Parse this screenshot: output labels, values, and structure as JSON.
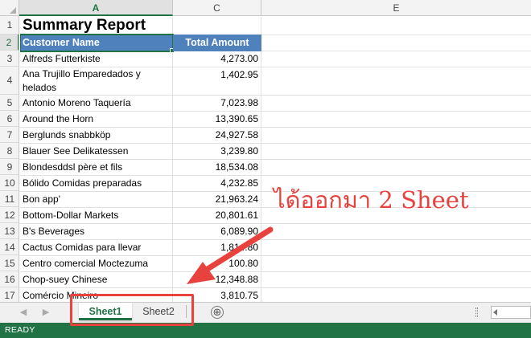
{
  "columns": [
    {
      "letter": "A",
      "selected": true
    },
    {
      "letter": "C",
      "selected": false
    },
    {
      "letter": "E",
      "selected": false
    }
  ],
  "rows": [
    "1",
    "2",
    "3",
    "4",
    "5",
    "6",
    "7",
    "8",
    "9",
    "10",
    "11",
    "12",
    "13",
    "14",
    "15",
    "16",
    "17"
  ],
  "selected_row": "2",
  "sheet": {
    "title": "Summary Report",
    "headers": {
      "customer": "Customer Name",
      "total": "Total Amount"
    },
    "records": [
      {
        "customer": "Alfreds Futterkiste",
        "total": "4,273.00"
      },
      {
        "customer": "Ana Trujillo Emparedados y helados",
        "total": "1,402.95"
      },
      {
        "customer": "Antonio Moreno Taquería",
        "total": "7,023.98"
      },
      {
        "customer": "Around the Horn",
        "total": "13,390.65"
      },
      {
        "customer": "Berglunds snabbköp",
        "total": "24,927.58"
      },
      {
        "customer": "Blauer See Delikatessen",
        "total": "3,239.80"
      },
      {
        "customer": "Blondesddsl père et fils",
        "total": "18,534.08"
      },
      {
        "customer": "Bólido Comidas preparadas",
        "total": "4,232.85"
      },
      {
        "customer": "Bon app'",
        "total": "21,963.24"
      },
      {
        "customer": "Bottom-Dollar Markets",
        "total": "20,801.61"
      },
      {
        "customer": "B's Beverages",
        "total": "6,089.90"
      },
      {
        "customer": "Cactus Comidas para llevar",
        "total": "1,814.80"
      },
      {
        "customer": "Centro comercial Moctezuma",
        "total": "100.80"
      },
      {
        "customer": "Chop-suey Chinese",
        "total": "12,348.88"
      },
      {
        "customer": "Comércio Mineiro",
        "total": "3,810.75"
      }
    ]
  },
  "tabs": [
    {
      "label": "Sheet1",
      "active": true
    },
    {
      "label": "Sheet2",
      "active": false
    }
  ],
  "add_sheet_glyph": "⊕",
  "status": "READY",
  "annotation": {
    "text": "ได้ออกมา 2 Sheet",
    "color": "#e8423f"
  },
  "colors": {
    "excel_green": "#217346",
    "header_fill": "#4f81bd",
    "header_text": "#ffffff"
  },
  "icons": {
    "nav_prev": "triangle-left-icon",
    "nav_next": "triangle-right-icon",
    "add_sheet": "plus-circle-icon"
  }
}
